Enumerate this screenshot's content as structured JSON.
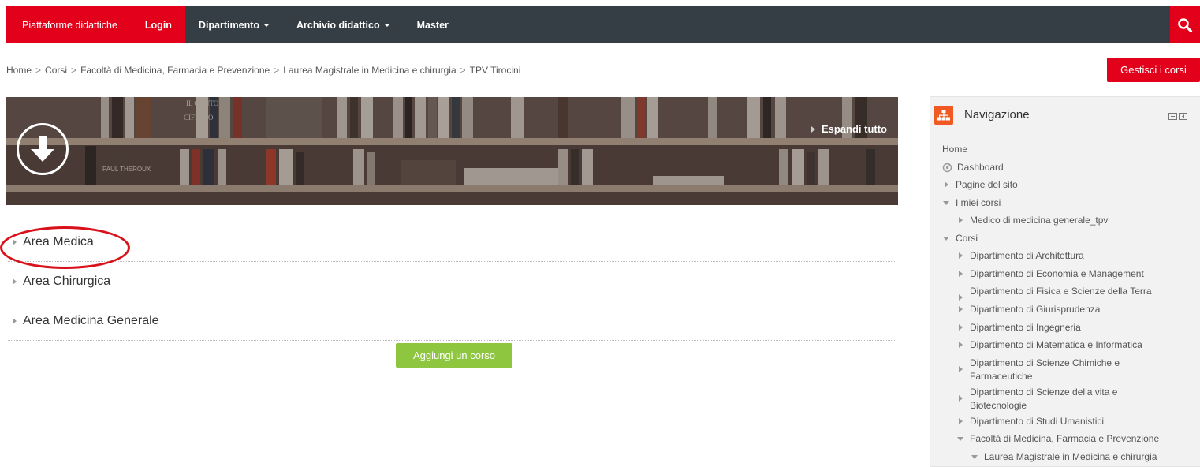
{
  "navbar": {
    "items": [
      {
        "label": "Piattaforme didattiche"
      },
      {
        "label": "Login"
      },
      {
        "label": "Dipartimento"
      },
      {
        "label": "Archivio didattico"
      },
      {
        "label": "Master"
      }
    ],
    "search_icon": "search-icon"
  },
  "breadcrumb": [
    "Home",
    "Corsi",
    "Facoltà di Medicina, Farmacia e Prevenzione",
    "Laurea Magistrale in Medicina e chirurgia",
    "TPV Tirocini"
  ],
  "breadcrumb_sep": ">",
  "manage_courses": "Gestisci i corsi",
  "banner": {
    "expand_all": "Espandi tutto",
    "book_texts": [
      "IL CONTO",
      "CIFRATO",
      "PAUL THEROUX"
    ]
  },
  "sections": [
    {
      "label": "Area Medica"
    },
    {
      "label": "Area Chirurgica"
    },
    {
      "label": "Area Medicina Generale"
    }
  ],
  "add_course": "Aggiungi un corso",
  "navigation": {
    "title": "Navigazione",
    "tree": [
      {
        "label": "Home",
        "level": 0,
        "icon": "none"
      },
      {
        "label": "Dashboard",
        "level": 0,
        "icon": "dashboard"
      },
      {
        "label": "Pagine del sito",
        "level": 0,
        "icon": "right"
      },
      {
        "label": "I miei corsi",
        "level": 0,
        "icon": "down"
      },
      {
        "label": "Medico di medicina generale_tpv",
        "level": 1,
        "icon": "right"
      },
      {
        "label": "Corsi",
        "level": 0,
        "icon": "down"
      },
      {
        "label": "Dipartimento di Architettura",
        "level": 1,
        "icon": "right"
      },
      {
        "label": "Dipartimento di Economia e Management",
        "level": 1,
        "icon": "right"
      },
      {
        "label": "Dipartimento di Fisica e Scienze della Terra",
        "level": 1,
        "icon": "right"
      },
      {
        "label": "Dipartimento di Giurisprudenza",
        "level": 1,
        "icon": "right"
      },
      {
        "label": "Dipartimento di Ingegneria",
        "level": 1,
        "icon": "right"
      },
      {
        "label": "Dipartimento di Matematica e Informatica",
        "level": 1,
        "icon": "right"
      },
      {
        "label": "Dipartimento di Scienze Chimiche e Farmaceutiche",
        "level": 1,
        "icon": "right"
      },
      {
        "label": "Dipartimento di Scienze della vita e Biotecnologie",
        "level": 1,
        "icon": "right"
      },
      {
        "label": "Dipartimento di Studi Umanistici",
        "level": 1,
        "icon": "right"
      },
      {
        "label": "Facoltà di Medicina, Farmacia e Prevenzione",
        "level": 1,
        "icon": "down"
      },
      {
        "label": "Laurea Magistrale in Medicina e chirurgia",
        "level": 2,
        "icon": "down"
      }
    ]
  },
  "colors": {
    "navbar_bg": "#353e44",
    "brand_red": "#e2001a",
    "add_green": "#8ec63f",
    "nav_icon_orange": "#f05a22"
  }
}
